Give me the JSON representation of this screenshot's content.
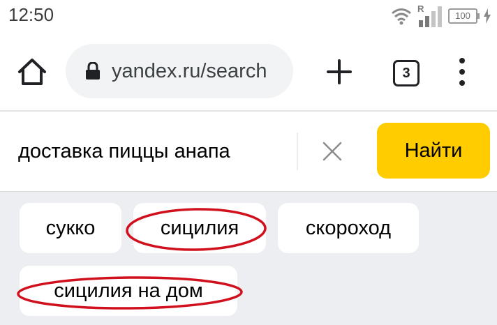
{
  "status_bar": {
    "time": "12:50",
    "signal_tag": "R",
    "battery": "100",
    "icons": [
      "wifi-icon",
      "signal-icon",
      "battery-icon",
      "charging-icon"
    ]
  },
  "browser": {
    "url": "yandex.ru/search",
    "tab_count": "3",
    "icons": [
      "home-icon",
      "lock-icon",
      "plus-icon",
      "tabs-icon",
      "menu-icon"
    ]
  },
  "search": {
    "query": "доставка пиццы анапа",
    "button_label": "Найти",
    "accent_color": "#ffcc00"
  },
  "suggestions": [
    {
      "label": "сукко",
      "circled": false
    },
    {
      "label": "сицилия",
      "circled": true
    },
    {
      "label": "скороход",
      "circled": false
    },
    {
      "label": "сицилия на дом",
      "circled": true
    }
  ],
  "annotation_color": "#d0101c"
}
